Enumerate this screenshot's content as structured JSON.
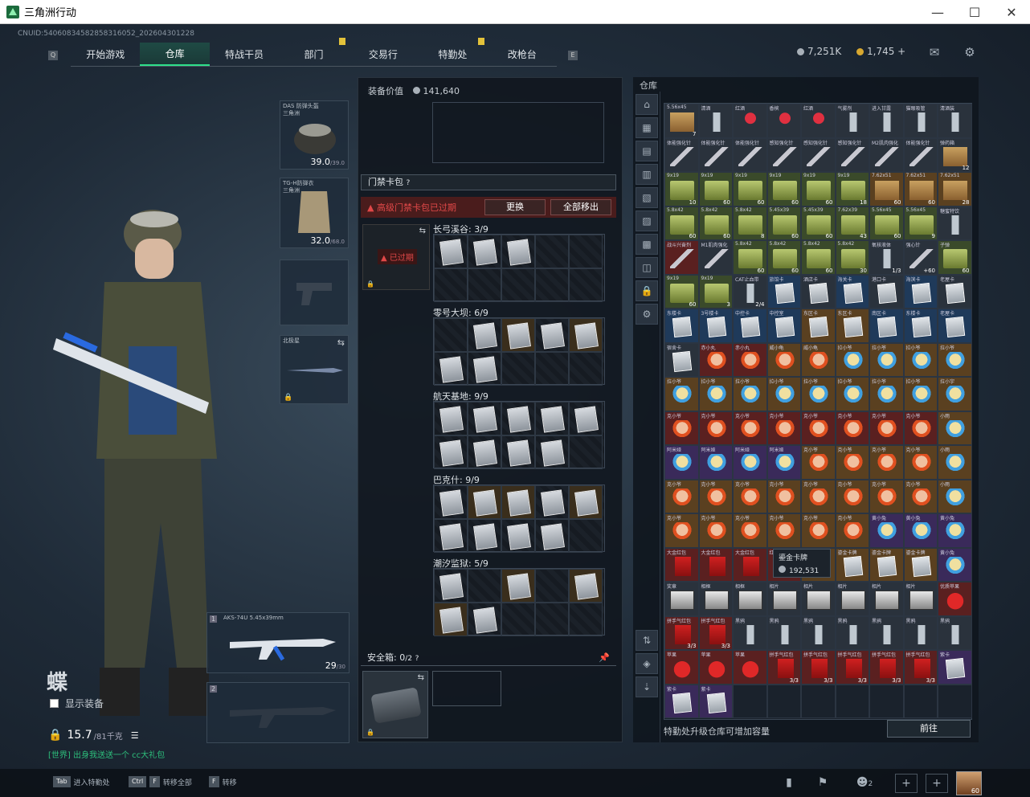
{
  "window": {
    "title": "三角洲行动",
    "minimize": "—",
    "maximize": "☐",
    "close": "✕"
  },
  "uid": "CNUID:54060834582858316052_202604301228",
  "nav": {
    "tabs": [
      "开始游戏",
      "仓库",
      "特战干员",
      "部门",
      "交易行",
      "特勤处",
      "改枪台"
    ],
    "active": 1
  },
  "currency": {
    "silver": "7,251K",
    "gold": "1,745 +"
  },
  "character": {
    "name": "蝶",
    "show_equipment": "显示装备",
    "weight": "15.7",
    "weight_max": "/81千克",
    "chat": "[世界] 出身我送送一个  cc大礼包"
  },
  "equipment": {
    "helmet": {
      "label": "DAS 防弹头盔\n三角洲",
      "value": "39.0",
      "max": "/39.0"
    },
    "armor": {
      "label": "TG-H防弹衣\n三角洲",
      "value": "32.0",
      "max": "/68.0"
    },
    "melee": {
      "label": "北极星"
    },
    "gun1": {
      "label": "AKS-74U\n5.45x39mm",
      "ammo": "29",
      "ammo_max": "/30"
    },
    "slot1": "1",
    "slot2": "2"
  },
  "center": {
    "value_label": "装备价值",
    "value": "141,640",
    "keycard_pack": "门禁卡包",
    "alert": "高级门禁卡包已过期",
    "replace_btn": "更换",
    "remove_all_btn": "全部移出",
    "expired": "已过期",
    "groups": [
      {
        "name": "长弓溪谷: 3/9"
      },
      {
        "name": "零号大坝: 6/9"
      },
      {
        "name": "航天基地: 9/9"
      },
      {
        "name": "巴克什: 9/9"
      },
      {
        "name": "潮汐监狱: 5/9"
      }
    ],
    "safebox": "安全箱:",
    "safebox_count": "0",
    "safebox_max": "/2"
  },
  "warehouse": {
    "title": "仓库",
    "footer": "特勤处升级仓库可增加容量",
    "go_btn": "前往",
    "tooltip_name": "鎏金卡牌",
    "tooltip_value": "192,531"
  },
  "bottom": {
    "hint1_key": "Tab",
    "hint1": "进入特勤处",
    "hint2_key": "Ctrl",
    "hint2_key2": "F",
    "hint2": "转移全部",
    "hint3_key": "F",
    "hint3": "转移",
    "squad": "2",
    "level": "60"
  },
  "inventory_rows": [
    [
      "t-gray|g-box|5.56x45|7",
      "t-gray|g-bottle|清酒||",
      "t-gray|g-drink|红酒||",
      "t-gray|g-drink|香槟||",
      "t-gray|g-drink|红酒||",
      "t-gray|g-bottle|气雾剂||",
      "t-gray|g-bottle|进入甘露||",
      "t-gray|g-bottle|猫眼吸管||",
      "t-gray|g-bottle|清酒装||"
    ],
    [
      "t-gray|g-syr|体能强化针||",
      "t-gray|g-syr|体能强化针||",
      "t-gray|g-syr|体能强化针||",
      "t-gray|g-syr|感知强化针||",
      "t-gray|g-syr|感知强化针||",
      "t-gray|g-syr|感知强化针||",
      "t-gray|g-syr|M2肌肉强化||",
      "t-gray|g-syr|体能强化针||",
      "t-gray|g-box|弹药箱|12"
    ],
    [
      "t-green|g-ammo|9x19|10",
      "t-green|g-ammo|9x19|60",
      "t-green|g-ammo|9x19|60",
      "t-green|g-ammo|9x19|60",
      "t-green|g-ammo|9x19|60",
      "t-green|g-ammo|9x19|18",
      "t-gold|g-box|7.62x51|60",
      "t-gold|g-box|7.62x51|60",
      "t-gold|g-box|7.62x51|28"
    ],
    [
      "t-green|g-ammo|5.8x42|60",
      "t-green|g-ammo|5.8x42|60",
      "t-green|g-ammo|5.8x42|8",
      "t-green|g-ammo|5.45x39|60",
      "t-green|g-ammo|5.45x39|60",
      "t-green|g-ammo|7.62x39|43",
      "t-green|g-ammo|5.56x45|60",
      "t-green|g-ammo|5.56x45|9",
      "t-gray|g-bottle|糖蜜特饮||"
    ],
    [
      "t-red|g-syr|战斗兴奋剂||",
      "t-gray|g-syr|M1肌肉强化||",
      "t-green|g-ammo|5.8x42|60",
      "t-green|g-ammo|5.8x42|60",
      "t-green|g-ammo|5.8x42|60",
      "t-green|g-ammo|5.8x42|30",
      "t-gray|g-bottle|氧核液体|1/3",
      "t-gray|g-syr|强心针|+60",
      "t-green|g-ammo|子弹|60"
    ],
    [
      "t-green|g-ammo|9x19|60",
      "t-green|g-ammo|9x19|3",
      "t-gray|g-bottle|CAT止血带|2/4",
      "t-blue|g-card|旅馆卡||",
      "t-gray|g-card|酒店卡||",
      "t-blue|g-card|海关卡||",
      "t-gray|g-card|港口卡||",
      "t-blue|g-card|海滨卡||",
      "t-gray|g-card|老屋卡||"
    ],
    [
      "t-blue|g-card|东楼卡||",
      "t-blue|g-card|3号楼卡||",
      "t-blue|g-card|中控卡||",
      "t-blue|g-card|中控室||",
      "t-gold|g-card|东区卡||",
      "t-gold|g-card|东区卡||",
      "t-blue|g-card|南区卡||",
      "t-blue|g-card|东楼卡||",
      "t-blue|g-card|老屋卡||"
    ],
    [
      "t-gray|g-card|宿舍卡||",
      "t-red|g-doll2|赤小丸||",
      "t-red|g-doll2|赤小丸||",
      "t-gold|g-doll2|威小龟||",
      "t-gold|g-doll2|威小龟||",
      "t-gold|g-doll|拉小爷||",
      "t-gold|g-doll|拉小爷||",
      "t-gold|g-doll|拉小爷||",
      "t-gold|g-doll|拉小爷||"
    ],
    [
      "t-gold|g-doll|拉小爷||",
      "t-gold|g-doll|拉小爷||",
      "t-gold|g-doll|拉小爷||",
      "t-gold|g-doll|拉小爷||",
      "t-gold|g-doll|拉小爷||",
      "t-gold|g-doll|拉小爷||",
      "t-gold|g-doll|拉小爷||",
      "t-gold|g-doll|拉小爷||",
      "t-gold|g-doll|拉小宇||"
    ],
    [
      "t-red|g-doll2|克小爷||",
      "t-red|g-doll2|克小爷||",
      "t-red|g-doll2|克小爷||",
      "t-red|g-doll2|克小爷||",
      "t-red|g-doll2|克小爷||",
      "t-red|g-doll2|克小爷||",
      "t-red|g-doll2|克小爷||",
      "t-red|g-doll2|克小爷||",
      "t-gold|g-doll|小雨||"
    ],
    [
      "t-purple|g-doll|阿米娅||",
      "t-purple|g-doll|阿米娅||",
      "t-purple|g-doll|阿米娅||",
      "t-purple|g-doll|阿米娅||",
      "t-gold|g-doll2|克小爷||",
      "t-gold|g-doll2|克小爷||",
      "t-gold|g-doll2|克小爷||",
      "t-gold|g-doll2|克小爷||",
      "t-gold|g-doll|小雨||"
    ],
    [
      "t-gold|g-doll2|克小爷||",
      "t-gold|g-doll2|克小爷||",
      "t-gold|g-doll2|克小爷||",
      "t-gold|g-doll2|克小爷||",
      "t-gold|g-doll2|克小爷||",
      "t-gold|g-doll2|克小爷||",
      "t-gold|g-doll2|克小爷||",
      "t-gold|g-doll2|克小爷||",
      "t-gold|g-doll|小雨||"
    ],
    [
      "t-gold|g-doll2|克小爷||",
      "t-gold|g-doll2|克小爷||",
      "t-gold|g-doll2|克小爷||",
      "t-gold|g-doll2|克小爷||",
      "t-gold|g-doll2|克小爷||",
      "t-gold|g-doll2|克小爷||",
      "t-purple|g-doll|黄小兔||",
      "t-purple|g-doll|黄小兔||",
      "t-purple|g-doll|黄小兔||"
    ],
    [
      "t-red|g-env|大金红包||",
      "t-red|g-env|大金红包||",
      "t-red|g-env|大金红包||",
      "t-red|g-env|红包||",
      "t-gold|g-card|鎏金卡牌||",
      "t-gold|g-card|鎏金卡牌||",
      "t-gold|g-card|鎏金卡牌||",
      "t-gold|g-card|鎏金卡牌||",
      "t-purple|g-doll|黄小兔||"
    ],
    [
      "t-gray|g-photo|奖章||",
      "t-gray|g-photo|相框||",
      "t-gray|g-photo|相框||",
      "t-gray|g-photo|相片||",
      "t-gray|g-photo|相片||",
      "t-gray|g-photo|相片||",
      "t-gray|g-photo|相片||",
      "t-gray|g-photo|相片||",
      "t-red|g-apple|优质苹果||"
    ],
    [
      "t-red|g-env|拼手气红包|3/3",
      "t-red|g-env|拼手气红包|3/3",
      "t-gray|g-bottle|黑鸦||",
      "t-gray|g-bottle|黑鸦||",
      "t-gray|g-bottle|黑鸦||",
      "t-gray|g-bottle|黑鸦||",
      "t-gray|g-bottle|黑鸦||",
      "t-gray|g-bottle|黑鸦||",
      "t-gray|g-bottle|黑鸦||"
    ],
    [
      "t-red|g-apple|苹果||",
      "t-red|g-apple|苹果||",
      "t-red|g-apple|苹果||",
      "t-red|g-env|拼手气红包|3/3",
      "t-red|g-env|拼手气红包|3/3",
      "t-red|g-env|拼手气红包|3/3",
      "t-red|g-env|拼手气红包|3/3",
      "t-red|g-env|拼手气红包|3/3",
      "t-purple|g-card|紫卡||"
    ],
    [
      "t-purple|g-card|紫卡||",
      "t-purple|g-card|紫卡||",
      "",
      "",
      "",
      "",
      "",
      "",
      ""
    ]
  ]
}
